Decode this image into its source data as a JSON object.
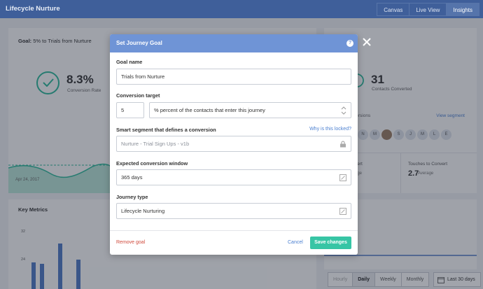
{
  "app": {
    "title": "Lifecycle Nurture"
  },
  "top_tabs": [
    {
      "label": "Canvas"
    },
    {
      "label": "Live View"
    },
    {
      "label": "Insights",
      "active": true
    }
  ],
  "goal_card": {
    "heading_bold": "Goal:",
    "heading_rest": " 5% to Trials from Nurture",
    "conversion_rate": "8.3%",
    "conversion_rate_label": "Conversion Rate",
    "trend_date": "Apr 24, 2017"
  },
  "right_card": {
    "heading": "s",
    "contacts_converted": "31",
    "contacts_converted_label": "Contacts Converted",
    "conversions_label": "versions",
    "view_segment": "View segment",
    "avatars": [
      "N",
      "M",
      "",
      "S",
      "J",
      "M",
      "L",
      "E"
    ],
    "left_stat_label": "vert",
    "left_stat_sub": "age",
    "touches_label": "Touches to Convert",
    "touches_value": "2.7",
    "touches_sub": "Average"
  },
  "metrics_card": {
    "heading": "Key Metrics",
    "y_ticks": [
      "32",
      "24"
    ]
  },
  "granularity": {
    "options": [
      {
        "label": "Hourly",
        "state": "faded"
      },
      {
        "label": "Daily",
        "state": "active"
      },
      {
        "label": "Weekly",
        "state": ""
      },
      {
        "label": "Monthly",
        "state": ""
      }
    ],
    "date_range": "Last 30 days"
  },
  "modal": {
    "title": "Set Journey Goal",
    "goal_name_label": "Goal name",
    "goal_name_value": "Trials from Nurture",
    "conversion_target_label": "Conversion target",
    "conversion_target_value": "5",
    "conversion_target_unit": "% percent of the contacts that enter this journey",
    "segment_label": "Smart segment that defines a conversion",
    "why_locked": "Why is this locked?",
    "segment_value": "Nurture - Trial Sign Ups - v1b",
    "window_label": "Expected conversion window",
    "window_value": "365 days",
    "journey_type_label": "Journey type",
    "journey_type_value": "Lifecycle Nurturing",
    "remove_goal": "Remove goal",
    "cancel": "Cancel",
    "save": "Save changes"
  },
  "colors": {
    "topbar": "#3f5f9a",
    "modal_header": "#6f94d6",
    "accent_green": "#37c5a5",
    "link_blue": "#4a7fd0",
    "danger_red": "#d04a3c"
  }
}
